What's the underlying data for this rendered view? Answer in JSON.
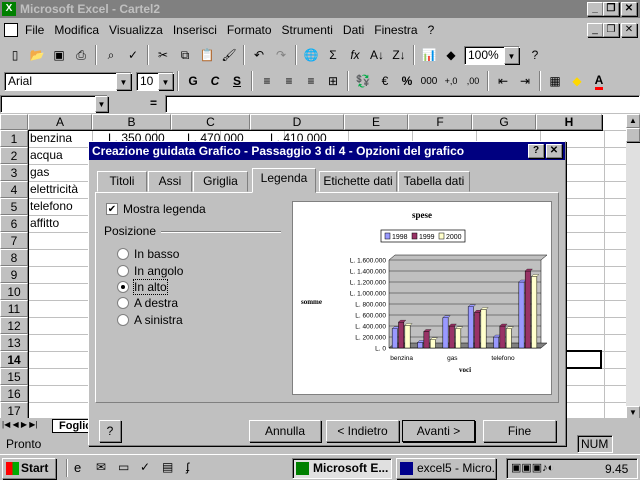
{
  "window": {
    "title": "Microsoft Excel - Cartel2"
  },
  "menu": [
    "File",
    "Modifica",
    "Visualizza",
    "Inserisci",
    "Formato",
    "Strumenti",
    "Dati",
    "Finestra",
    "?"
  ],
  "toolbar": {
    "zoom": "100%",
    "font": "Arial",
    "size": "10"
  },
  "formula": {
    "equals": "="
  },
  "sheet": {
    "columns": [
      "A",
      "B",
      "C",
      "D",
      "E",
      "F",
      "G",
      "H"
    ],
    "rows": [
      "1",
      "2",
      "3",
      "4",
      "5",
      "6",
      "7",
      "8",
      "9",
      "10",
      "11",
      "12",
      "13",
      "14",
      "15",
      "16",
      "17"
    ],
    "cells": {
      "A1": "benzina",
      "A2": "acqua",
      "A3": "gas",
      "A4": "elettricità",
      "A5": "telefono",
      "A6": "affitto",
      "B1": "L. 350.000",
      "C1": "L. 470.000",
      "D1": "L. 410.000"
    },
    "tab": "Foglio"
  },
  "dialog": {
    "title": "Creazione guidata Grafico - Passaggio 3 di 4 - Opzioni del grafico",
    "tabs": [
      "Titoli",
      "Assi",
      "Griglia",
      "Legenda",
      "Etichette dati",
      "Tabella dati"
    ],
    "active_tab": "Legenda",
    "show_legend": {
      "label": "Mostra legenda",
      "checked": true
    },
    "position_label": "Posizione",
    "positions": [
      "In basso",
      "In angolo",
      "In alto",
      "A destra",
      "A sinistra"
    ],
    "selected_position": "In alto",
    "buttons": {
      "help": "?",
      "cancel": "Annulla",
      "back": "< Indietro",
      "next": "Avanti >",
      "finish": "Fine"
    }
  },
  "chart_data": {
    "type": "bar",
    "title": "spese",
    "xlabel": "voci",
    "ylabel": "somme",
    "categories": [
      "benzina",
      "acqua",
      "gas",
      "elettricità",
      "telefono",
      "affitto"
    ],
    "x_tick_labels": [
      "benzina",
      "gas",
      "telefono"
    ],
    "series": [
      {
        "name": "1998",
        "color": "#9999ff",
        "values": [
          350000,
          100000,
          550000,
          750000,
          200000,
          1200000
        ]
      },
      {
        "name": "1999",
        "color": "#993366",
        "values": [
          470000,
          300000,
          400000,
          650000,
          400000,
          1400000
        ]
      },
      {
        "name": "2000",
        "color": "#ffffcc",
        "values": [
          410000,
          150000,
          350000,
          700000,
          350000,
          1300000
        ]
      }
    ],
    "y_ticks": [
      "L. 0",
      "L. 200.000",
      "L. 400.000",
      "L. 600.000",
      "L. 800.000",
      "L. 1.000.000",
      "L. 1.200.000",
      "L. 1.400.000",
      "L. 1.600.000"
    ],
    "ylim": [
      0,
      1600000
    ],
    "legend_position": "top",
    "grid": true
  },
  "status": {
    "text": "Pronto",
    "num": "NUM"
  },
  "taskbar": {
    "start": "Start",
    "tasks": [
      "Microsoft E...",
      "excel5 - Micro..."
    ],
    "clock": "9.45"
  }
}
